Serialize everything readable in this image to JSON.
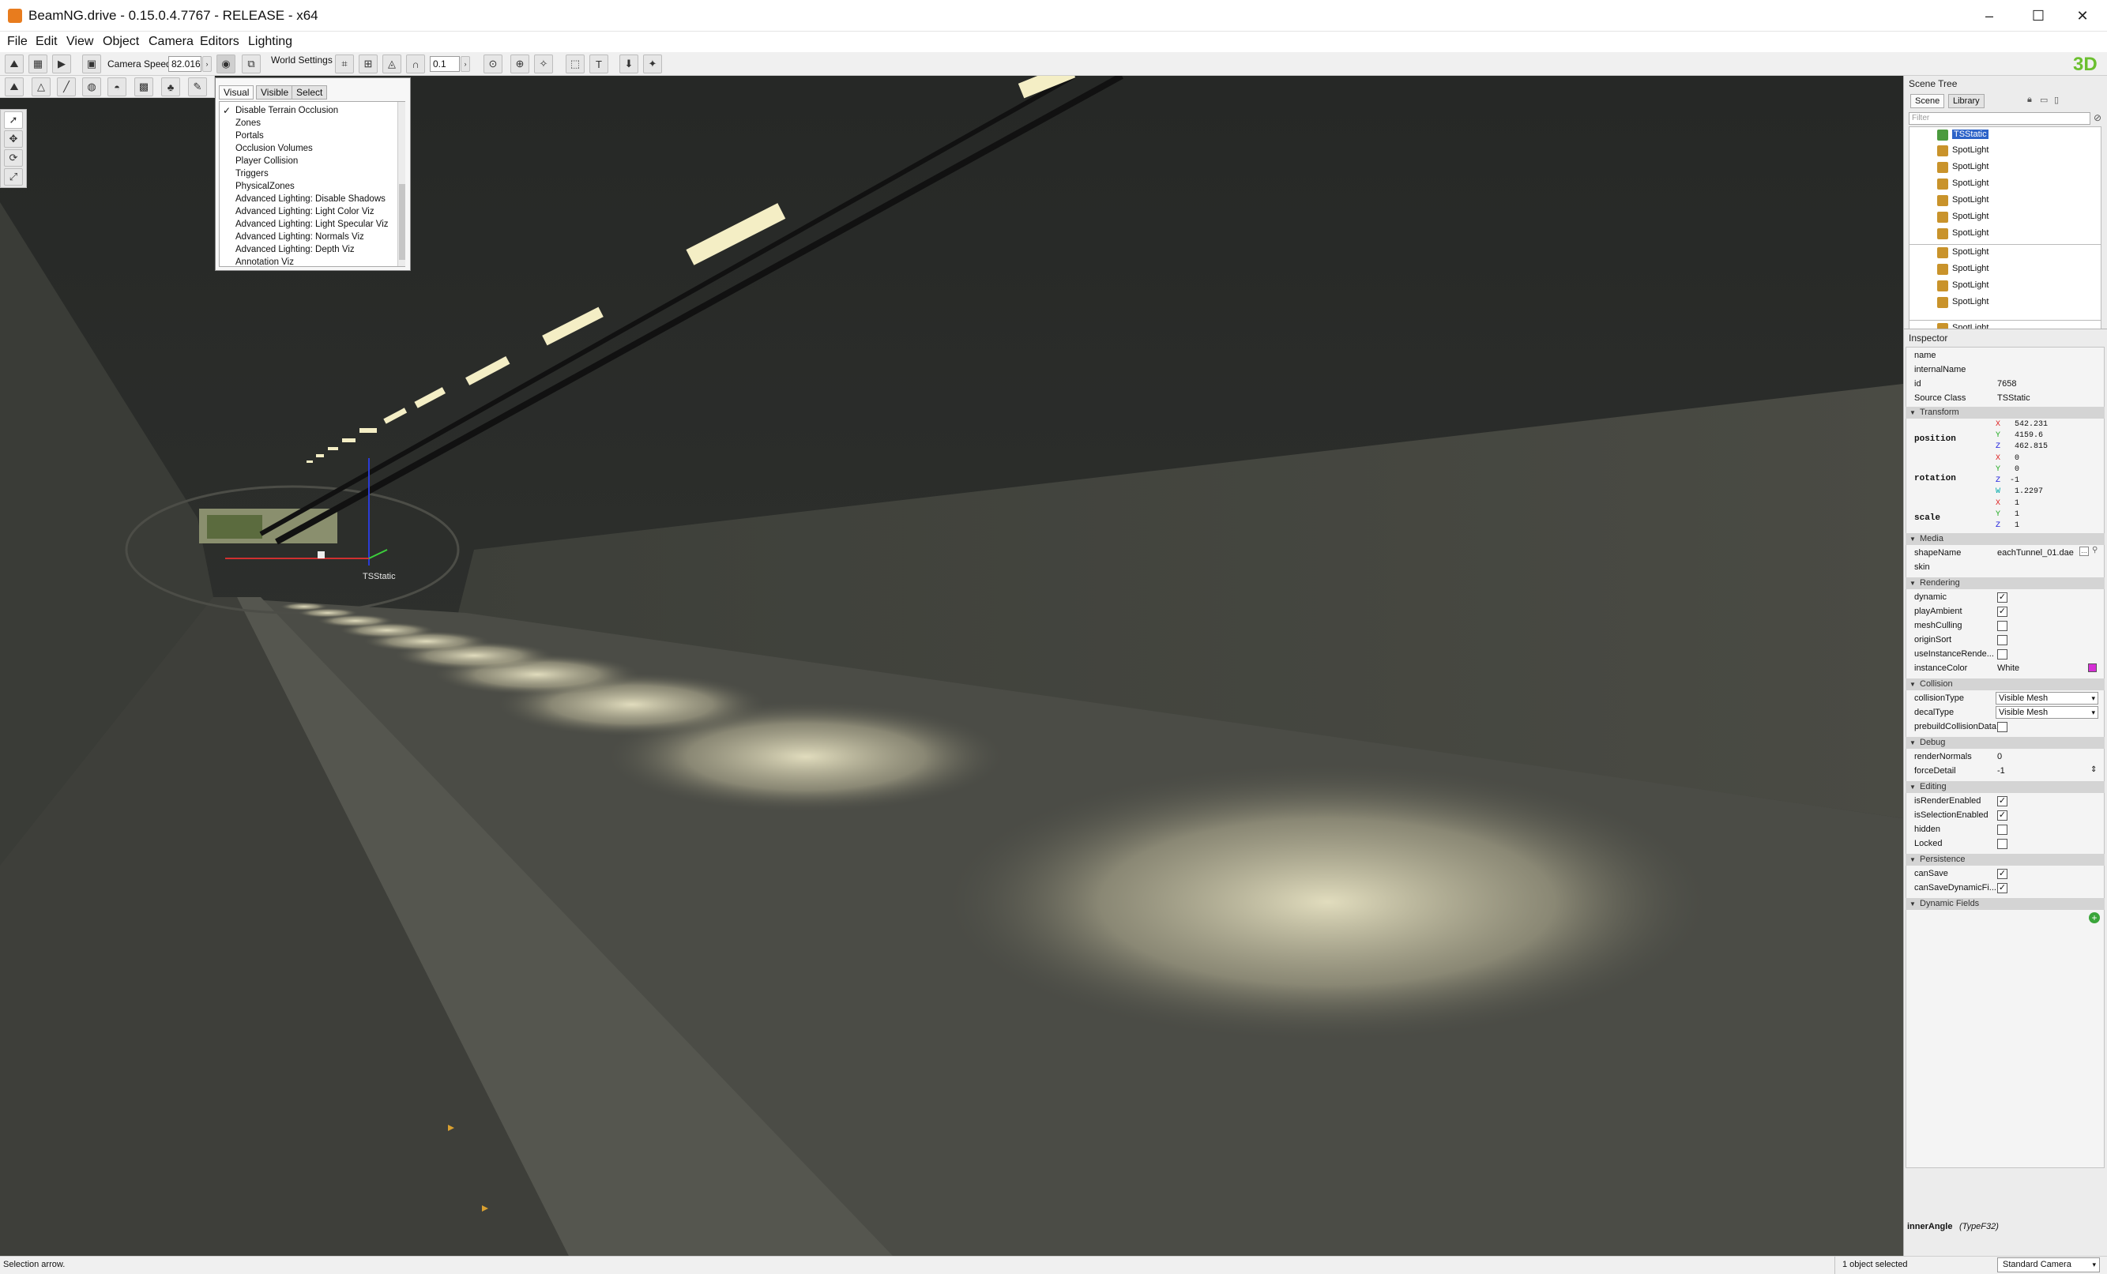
{
  "window": {
    "title": "BeamNG.drive - 0.15.0.4.7767 - RELEASE - x64",
    "controls": [
      "–",
      "☐",
      "✕"
    ]
  },
  "menu": [
    "File",
    "Edit",
    "View",
    "Object",
    "Camera",
    "Editors",
    "Lighting"
  ],
  "toolbar": {
    "camera_speed_label": "Camera Speed",
    "camera_speed_value": "82.016",
    "world_settings_label": "World Settings",
    "snap_value": "0.1",
    "logo": "3D"
  },
  "visibility_popup": {
    "tabs": [
      "Visual",
      "Visible",
      "Select"
    ],
    "items": [
      {
        "label": "Disable Terrain Occlusion",
        "checked": true
      },
      {
        "label": "Zones",
        "checked": false
      },
      {
        "label": "Portals",
        "checked": false
      },
      {
        "label": "Occlusion Volumes",
        "checked": false
      },
      {
        "label": "Player Collision",
        "checked": false
      },
      {
        "label": "Triggers",
        "checked": false
      },
      {
        "label": "PhysicalZones",
        "checked": false
      },
      {
        "label": "Advanced Lighting: Disable Shadows",
        "checked": false
      },
      {
        "label": "Advanced Lighting: Light Color Viz",
        "checked": false
      },
      {
        "label": "Advanced Lighting: Light Specular Viz",
        "checked": false
      },
      {
        "label": "Advanced Lighting: Normals Viz",
        "checked": false
      },
      {
        "label": "Advanced Lighting: Depth Viz",
        "checked": false
      },
      {
        "label": "Annotation Viz",
        "checked": false
      }
    ]
  },
  "viewport": {
    "selected_object_label": "TSStatic"
  },
  "scene_tree": {
    "title": "Scene Tree",
    "tabs": [
      "Scene",
      "Library"
    ],
    "filter_placeholder": "Filter",
    "items": [
      "TSStatic",
      "SpotLight",
      "SpotLight",
      "SpotLight",
      "SpotLight",
      "SpotLight",
      "SpotLight",
      "SpotLight",
      "SpotLight",
      "SpotLight",
      "SpotLight",
      "SpotLight"
    ]
  },
  "inspector": {
    "title": "Inspector",
    "fields": {
      "name": {
        "label": "name",
        "value": ""
      },
      "internalName": {
        "label": "internalName",
        "value": ""
      },
      "id": {
        "label": "id",
        "value": "7658"
      },
      "sourceClass": {
        "label": "Source Class",
        "value": "TSStatic"
      }
    },
    "sections": {
      "transform": "Transform",
      "media": "Media",
      "rendering": "Rendering",
      "collision": "Collision",
      "debug": "Debug",
      "editing": "Editing",
      "persistence": "Persistence",
      "dynamic": "Dynamic Fields"
    },
    "position": {
      "label": "position",
      "x": "542.231",
      "y": "4159.6",
      "z": "462.815"
    },
    "rotation": {
      "label": "rotation",
      "x": "0",
      "y": "0",
      "z": "-1",
      "w": "1.2297"
    },
    "scale": {
      "label": "scale",
      "x": "1",
      "y": "1",
      "z": "1"
    },
    "shapeName": {
      "label": "shapeName",
      "value": "eachTunnel_01.dae"
    },
    "skin": {
      "label": "skin",
      "value": ""
    },
    "rendering": [
      {
        "label": "dynamic",
        "checked": true
      },
      {
        "label": "playAmbient",
        "checked": true
      },
      {
        "label": "meshCulling",
        "checked": false
      },
      {
        "label": "originSort",
        "checked": false
      },
      {
        "label": "useInstanceRende...",
        "checked": false
      }
    ],
    "instanceColor": {
      "label": "instanceColor",
      "value": "White",
      "swatch": "#d62ed6"
    },
    "collisionType": {
      "label": "collisionType",
      "value": "Visible Mesh"
    },
    "decalType": {
      "label": "decalType",
      "value": "Visible Mesh"
    },
    "prebuild": {
      "label": "prebuildCollisionData",
      "checked": false
    },
    "renderNormals": {
      "label": "renderNormals",
      "value": "0"
    },
    "forceDetail": {
      "label": "forceDetail",
      "value": "-1"
    },
    "editing": [
      {
        "label": "isRenderEnabled",
        "checked": true
      },
      {
        "label": "isSelectionEnabled",
        "checked": true
      },
      {
        "label": "hidden",
        "checked": false
      },
      {
        "label": "Locked",
        "checked": false
      }
    ],
    "persistence": [
      {
        "label": "canSave",
        "checked": true
      },
      {
        "label": "canSaveDynamicFi...",
        "checked": true
      }
    ],
    "footer_field": "innerAngle",
    "footer_type": "(TypeF32)"
  },
  "status": {
    "left": "Selection arrow.",
    "selection": "1 object selected",
    "camera": "Standard Camera"
  }
}
